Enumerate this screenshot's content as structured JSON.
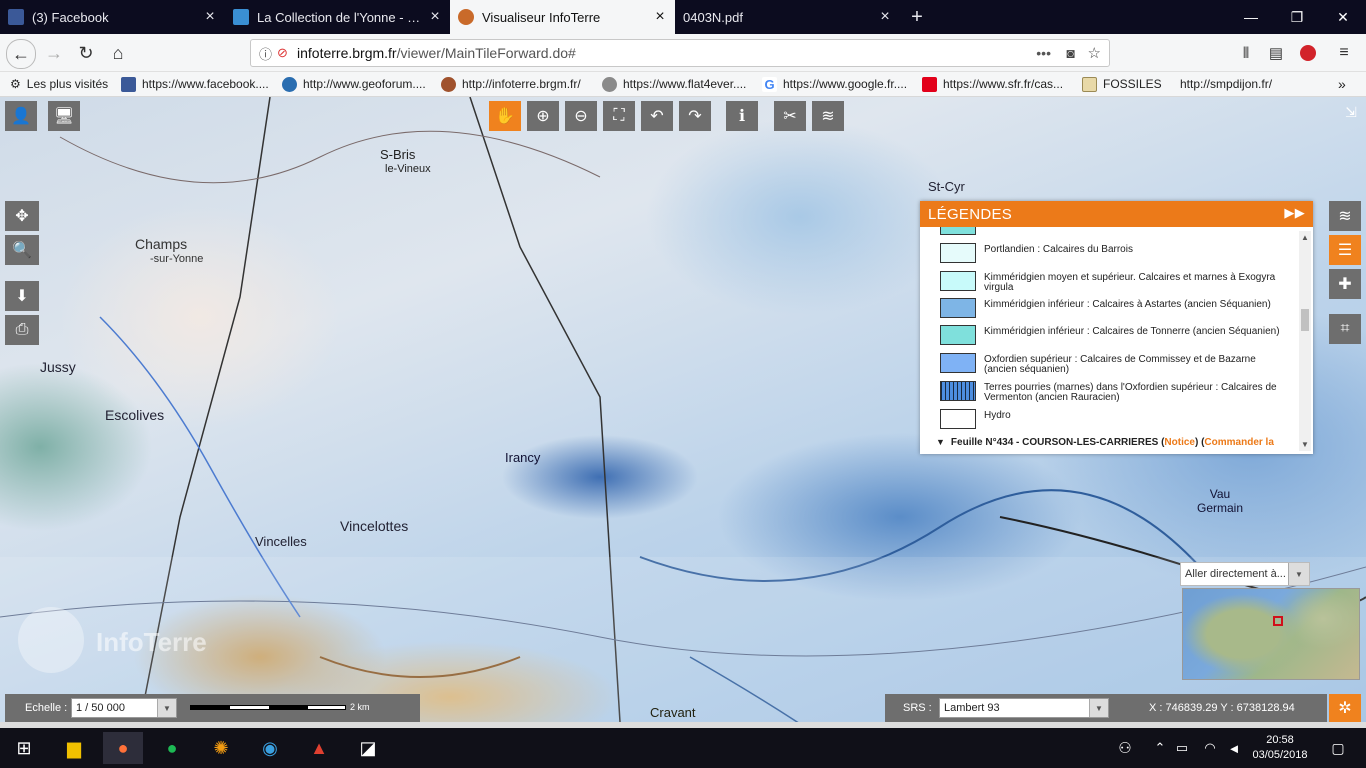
{
  "tabs": [
    {
      "title": "(3) Facebook",
      "close": "×"
    },
    {
      "title": "La Collection de l'Yonne - Forum",
      "close": "×"
    },
    {
      "title": "Visualiseur InfoTerre",
      "close": "×"
    },
    {
      "title": "0403N.pdf",
      "close": "×"
    }
  ],
  "new_tab": "+",
  "window_controls": {
    "minimize": "—",
    "maximize": "❐",
    "close": "✕"
  },
  "nav": {
    "back": "←",
    "forward": "→",
    "reload": "↻",
    "home": "⌂",
    "url_host": "infoterre.brgm.fr",
    "url_path": "/viewer/MainTileForward.do#",
    "more": "•••"
  },
  "bookmarks": [
    {
      "label": "Les plus visités"
    },
    {
      "label": "https://www.facebook...."
    },
    {
      "label": "http://www.geoforum...."
    },
    {
      "label": "http://infoterre.brgm.fr/"
    },
    {
      "label": "https://www.flat4ever...."
    },
    {
      "label": "https://www.google.fr...."
    },
    {
      "label": "https://www.sfr.fr/cas..."
    },
    {
      "label": "FOSSILES"
    },
    {
      "label": "http://smpdijon.fr/"
    }
  ],
  "map_labels": {
    "sbris": "S-Bris",
    "vineux": "le-Vineux",
    "champs": "Champs",
    "sur_yonne": "-sur-Yonne",
    "jussy": "Jussy",
    "escolives": "Escolives",
    "irancy": "Irancy",
    "vincelottes": "Vincelottes",
    "vincelles": "Vincelles",
    "vau_germain": "Vau Germain",
    "cravant": "Cravant",
    "st_cyr": "St-Cyr",
    "infoterre_logo": "InfoTerre"
  },
  "legend": {
    "title": "LÉGENDES",
    "items": [
      {
        "label": "Portlandien : Calcaires du Barrois",
        "color": "#e6fbfb"
      },
      {
        "label": "Kimméridgien moyen et supérieur. Calcaires et marnes à Exogyra virgula",
        "color": "#c8fafa"
      },
      {
        "label": "Kimméridgien inférieur : Calcaires à Astartes (ancien Séquanien)",
        "color": "#7eb5e6"
      },
      {
        "label": "Kimméridgien inférieur : Calcaires de Tonnerre (ancien Séquanien)",
        "color": "#7fe0dc"
      },
      {
        "label": "Oxfordien supérieur : Calcaires de Commissey et de Bazarne (ancien séquanien)",
        "color": "#7fb2f5"
      },
      {
        "label": "Terres pourries (marnes) dans l'Oxfordien supérieur : Calcaires de Vermenton (ancien Rauracien)",
        "color": "#4d8ee0"
      },
      {
        "label": "Hydro",
        "color": "#ffffff"
      }
    ],
    "feuille_prefix": "Feuille N°434 - COURSON-LES-CARRIERES (",
    "feuille_notice": "Notice",
    "feuille_mid": ") (",
    "feuille_order": "Commander la"
  },
  "scale": {
    "label": "Echelle :",
    "value": "1 / 50 000",
    "bar_label": "2 km"
  },
  "srs": {
    "label": "SRS :",
    "value": "Lambert 93",
    "coords": "X : 746839.29 Y : 6738128.94"
  },
  "goto": {
    "placeholder": "Aller directement à..."
  },
  "taskbar": {
    "time": "20:58",
    "date": "03/05/2018"
  }
}
